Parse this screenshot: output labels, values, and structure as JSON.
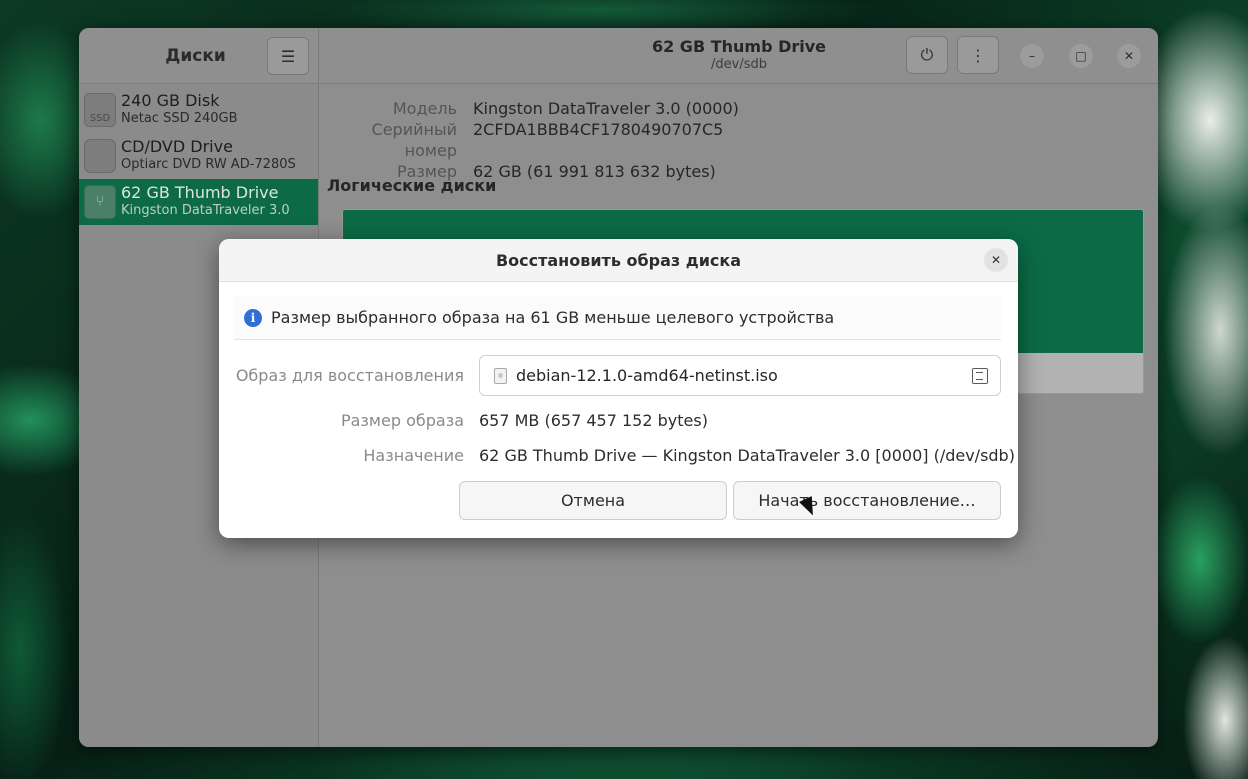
{
  "sidebar": {
    "title": "Диски",
    "menu_icon": "hamburger-icon",
    "drives": [
      {
        "name": "240 GB Disk",
        "sub": "Netac SSD 240GB",
        "icon": "ssd-icon",
        "icon_text": "SSD"
      },
      {
        "name": "CD/DVD Drive",
        "sub": "Optiarc DVD RW AD-7280S",
        "icon": "optical-drive-icon"
      },
      {
        "name": "62 GB Thumb Drive",
        "sub": "Kingston DataTraveler 3.0",
        "icon": "usb-icon",
        "selected": true
      }
    ]
  },
  "header": {
    "title": "62 GB Thumb Drive",
    "subtitle": "/dev/sdb",
    "power_icon": "power-icon",
    "menu_icon": "kebab-menu-icon"
  },
  "details": {
    "model_label": "Модель",
    "model_value": "Kingston DataTraveler 3.0 (0000)",
    "serial_label": "Серийный номер",
    "serial_value": "2CFDA1BBB4CF1780490707C5",
    "size_label": "Размер",
    "size_value": "62 GB (61 991 813 632 bytes)",
    "volumes_title": "Логические диски"
  },
  "dialog": {
    "title": "Восстановить образ диска",
    "info_text": "Размер выбранного образа на 61 GB меньше целевого устройства",
    "image_label": "Образ для восстановления",
    "image_file": "debian-12.1.0-amd64-netinst.iso",
    "image_size_label": "Размер образа",
    "image_size_value": "657 MB (657 457 152 bytes)",
    "destination_label": "Назначение",
    "destination_value": "62 GB Thumb Drive — Kingston DataTraveler 3.0 [0000] (/dev/sdb)",
    "cancel_label": "Отмена",
    "start_label": "Начать восстановление…"
  },
  "colors": {
    "accent": "#0d6a46",
    "info_blue": "#2f6fd6"
  }
}
